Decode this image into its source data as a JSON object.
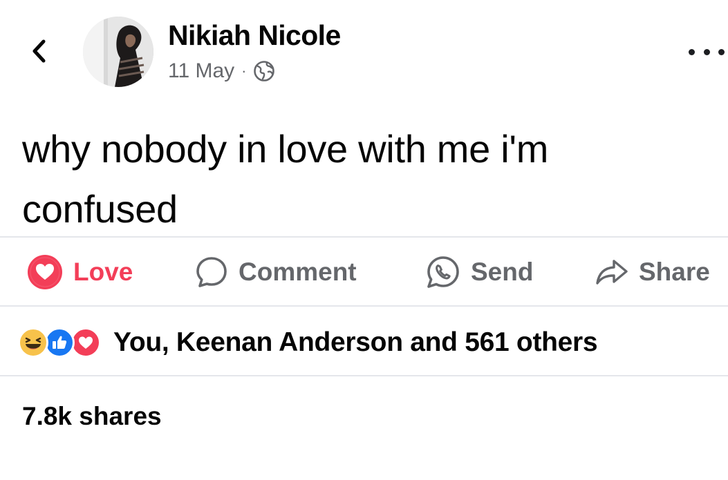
{
  "post": {
    "author": "Nikiah Nicole",
    "date": "11 May",
    "separator": "·",
    "visibility_icon": "globe-icon",
    "text_line1": "why nobody in love with me i'm",
    "text_line2": "confused"
  },
  "actions": {
    "love": "Love",
    "comment": "Comment",
    "send": "Send",
    "share": "Share"
  },
  "reactions": {
    "icons": [
      "haha-emoji-icon",
      "like-icon",
      "heart-icon"
    ],
    "summary": "You, Keenan Anderson and 561 others"
  },
  "shares": "7.8k shares",
  "colors": {
    "love": "#f33e58",
    "like": "#1877f2",
    "haha": "#f7c24b",
    "muted": "#65676b"
  }
}
